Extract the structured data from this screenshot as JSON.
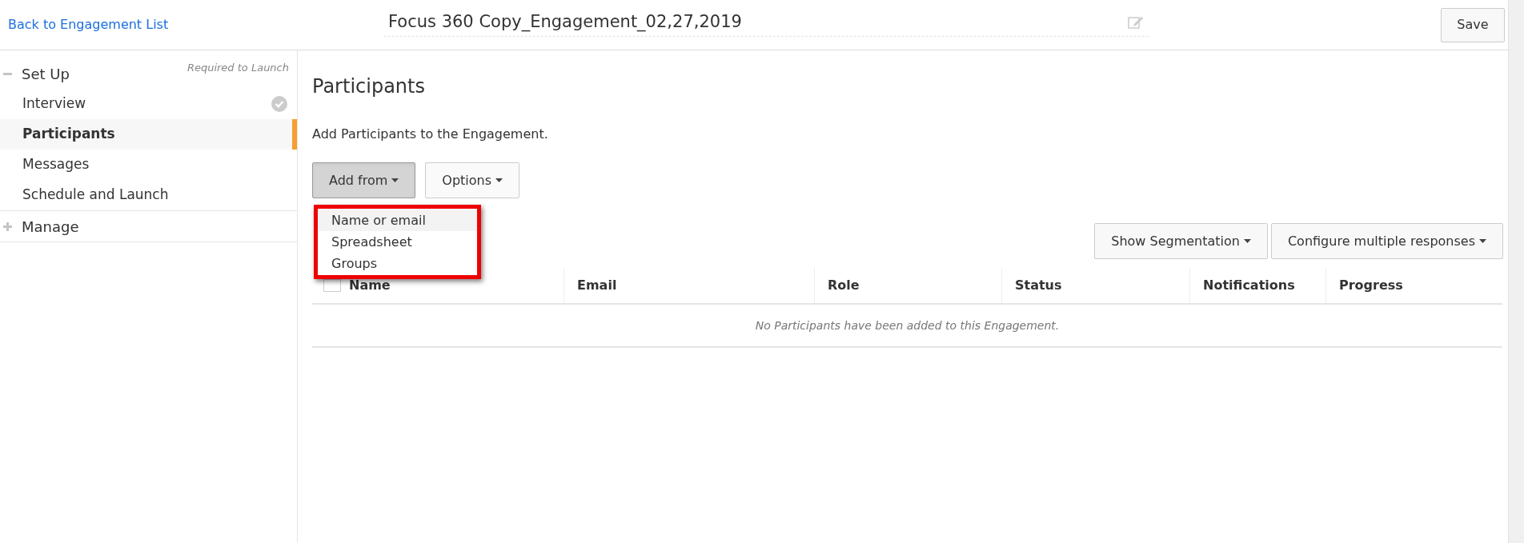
{
  "header": {
    "back_link": "Back to Engagement List",
    "title": "Focus 360 Copy_Engagement_02,27,2019",
    "save_button": "Save"
  },
  "sidebar": {
    "sections": [
      {
        "label": "Set Up",
        "expanded": true,
        "note": "Required to Launch",
        "items": [
          {
            "label": "Interview",
            "completed": true,
            "selected": false
          },
          {
            "label": "Participants",
            "completed": false,
            "selected": true
          },
          {
            "label": "Messages",
            "completed": false,
            "selected": false
          },
          {
            "label": "Schedule and Launch",
            "completed": false,
            "selected": false
          }
        ]
      },
      {
        "label": "Manage",
        "expanded": false
      }
    ]
  },
  "main": {
    "heading": "Participants",
    "description": "Add Participants to the Engagement.",
    "buttons": [
      {
        "label": "Add from",
        "pressed": true
      },
      {
        "label": "Options",
        "pressed": false
      }
    ],
    "dropdown": {
      "items": [
        {
          "label": "Name or email",
          "highlighted": true
        },
        {
          "label": "Spreadsheet",
          "highlighted": false
        },
        {
          "label": "Groups",
          "highlighted": false
        }
      ]
    },
    "table_buttons": [
      "Show Segmentation",
      "Configure multiple responses"
    ],
    "table": {
      "select_all_checked": false,
      "columns": [
        "Name",
        "Email",
        "Role",
        "Status",
        "Notifications",
        "Progress"
      ],
      "empty_message": "No Participants have been added to this Engagement."
    }
  }
}
